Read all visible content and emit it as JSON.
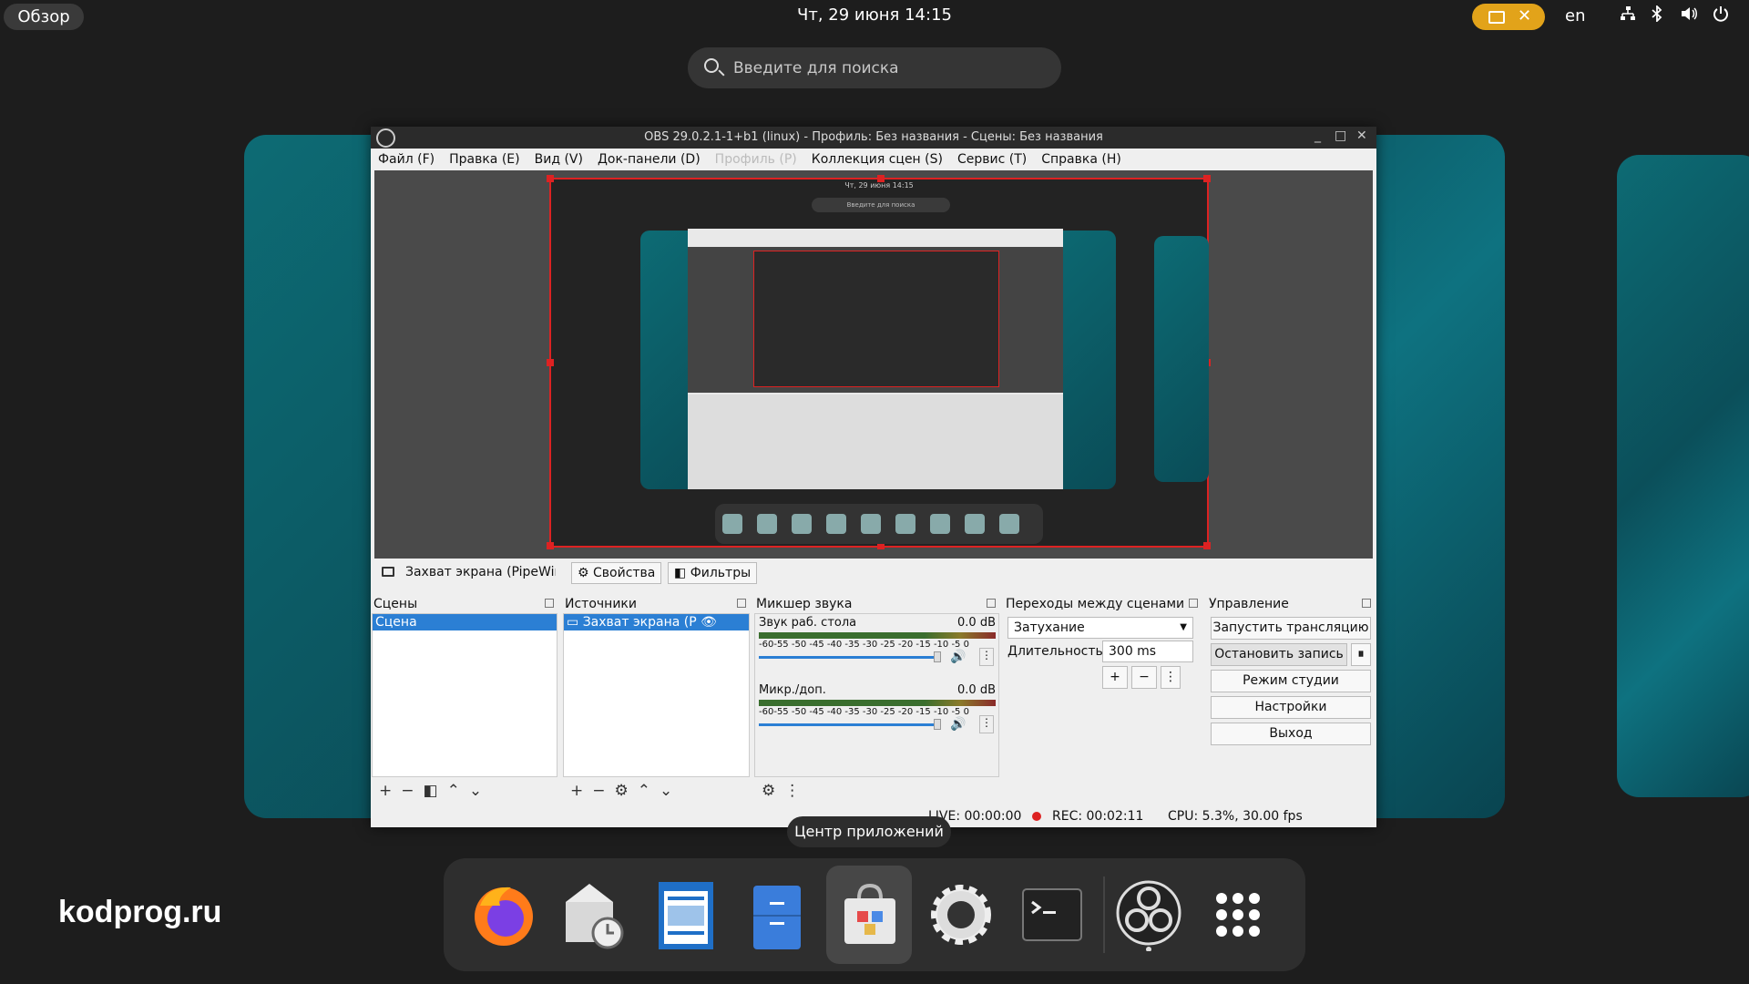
{
  "topbar": {
    "overview": "Обзор",
    "clock": "Чт, 29 июня  14:15",
    "lang": "en"
  },
  "search": {
    "placeholder": "Введите для поиска"
  },
  "obs": {
    "title": "OBS 29.0.2.1-1+b1 (linux) - Профиль: Без названия - Сцены: Без названия",
    "menu": [
      "Файл (F)",
      "Правка (E)",
      "Вид (V)",
      "Док-панели (D)",
      "Профиль (P)",
      "Коллекция сцен (S)",
      "Сервис (T)",
      "Справка (H)"
    ],
    "source_name": "Захват экрана (PipeWir",
    "properties": "Свойства",
    "filters": "Фильтры",
    "scenes": {
      "title": "Сцены",
      "items": [
        "Сцена"
      ]
    },
    "sources": {
      "title": "Источники",
      "items": [
        "Захват экрана (P"
      ]
    },
    "mixer": {
      "title": "Микшер звука",
      "channels": [
        {
          "name": "Звук раб. стола",
          "db": "0.0 dB",
          "scale": "-60-55 -50 -45 -40 -35 -30 -25 -20 -15 -10 -5 0"
        },
        {
          "name": "Микр./доп.",
          "db": "0.0 dB",
          "scale": "-60-55 -50 -45 -40 -35 -30 -25 -20 -15 -10 -5 0"
        }
      ]
    },
    "transitions": {
      "title": "Переходы между сценами",
      "type": "Затухание",
      "duration_label": "Длительность",
      "duration": "300 ms"
    },
    "controls": {
      "title": "Управление",
      "start_stream": "Запустить трансляцию",
      "stop_record": "Остановить запись",
      "studio_mode": "Режим студии",
      "settings": "Настройки",
      "exit": "Выход"
    },
    "status": {
      "live": "LIVE: 00:00:00",
      "rec": "REC: 00:02:11",
      "cpu": "CPU: 5.3%, 30.00 fps"
    }
  },
  "tooltip": "Центр приложений",
  "dash_icons": [
    "firefox-icon",
    "evolution-icon",
    "writer-icon",
    "files-icon",
    "software-center-icon",
    "settings-icon",
    "terminal-icon",
    "obs-icon",
    "app-grid-icon"
  ],
  "watermark": "kodprog.ru"
}
